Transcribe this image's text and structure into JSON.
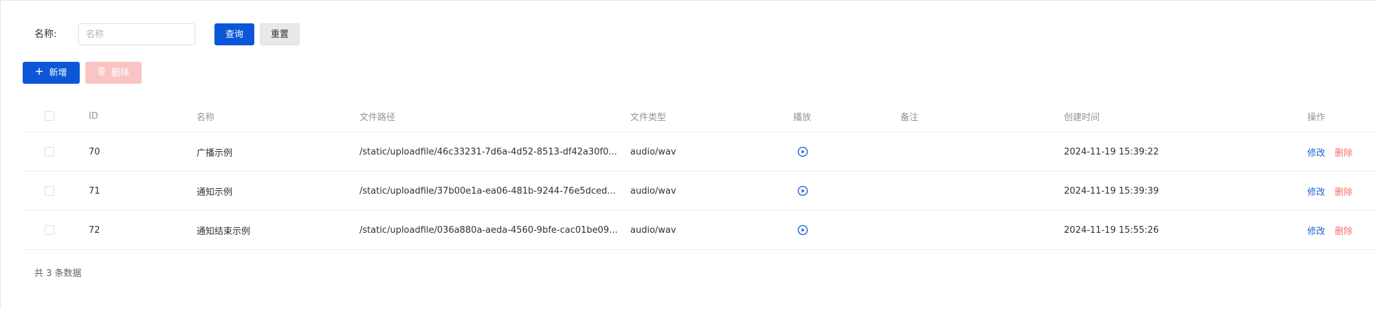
{
  "search": {
    "label": "名称:",
    "placeholder": "名称",
    "value": "",
    "query_label": "查询",
    "reset_label": "重置"
  },
  "toolbar": {
    "add_label": "新增",
    "delete_label": "删除",
    "add_icon": "plus-icon",
    "delete_icon": "trash-icon"
  },
  "table": {
    "columns": {
      "id": "ID",
      "name": "名称",
      "path": "文件路径",
      "type": "文件类型",
      "play": "播放",
      "remark": "备注",
      "created": "创建时间",
      "ops": "操作"
    },
    "rows": [
      {
        "id": "70",
        "name": "广播示例",
        "path": "/static/uploadfile/46c33231-7d6a-4d52-8513-df42a30f0...",
        "type": "audio/wav",
        "remark": "",
        "created": "2024-11-19 15:39:22",
        "edit": "修改",
        "delete": "删除"
      },
      {
        "id": "71",
        "name": "通知示例",
        "path": "/static/uploadfile/37b00e1a-ea06-481b-9244-76e5dced...",
        "type": "audio/wav",
        "remark": "",
        "created": "2024-11-19 15:39:39",
        "edit": "修改",
        "delete": "删除"
      },
      {
        "id": "72",
        "name": "通知结束示例",
        "path": "/static/uploadfile/036a880a-aeda-4560-9bfe-cac01be09...",
        "type": "audio/wav",
        "remark": "",
        "created": "2024-11-19 15:55:26",
        "edit": "修改",
        "delete": "删除"
      }
    ]
  },
  "footer": {
    "total_text": "共 3 条数据"
  },
  "colors": {
    "primary": "#0b57d8",
    "danger": "#f56c6c",
    "danger_disabled": "#fbc4c4",
    "link": "#1f5fd6"
  }
}
